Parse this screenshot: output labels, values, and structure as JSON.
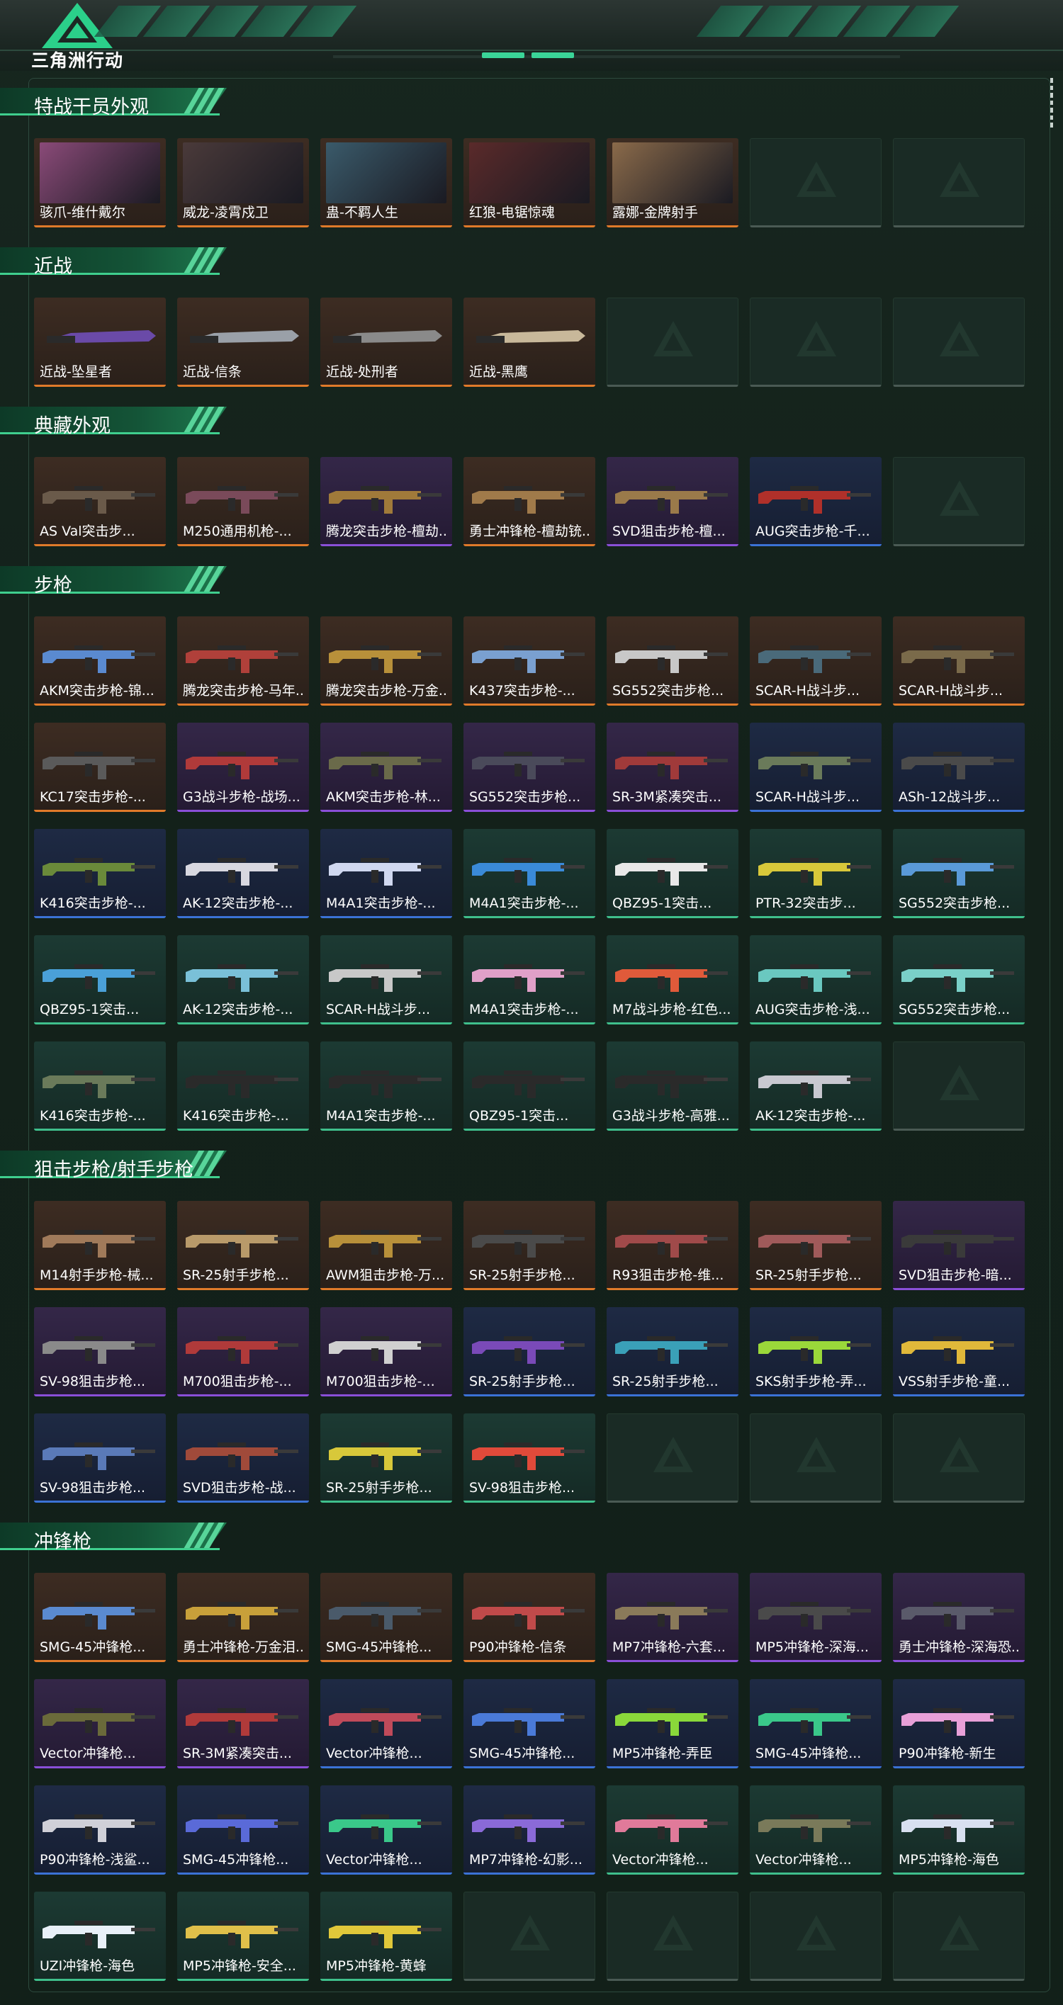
{
  "header": {
    "brand": "三角洲行动"
  },
  "colors": {
    "accent": "#3fcf8e",
    "orange": "#e07a2a",
    "purple": "#8a4fd8",
    "blue": "#3b72d6",
    "green": "#3fbf8c",
    "empty": "#4a5a54"
  },
  "sections": [
    {
      "title": "特战干员外观",
      "rows": [
        [
          {
            "name": "骇爪-维什戴尔",
            "rarity": "orange",
            "kind": "photo",
            "tint": "#8a4a78"
          },
          {
            "name": "威龙-凌霄戍卫",
            "rarity": "orange",
            "kind": "photo",
            "tint": "#4a3a3a"
          },
          {
            "name": "蛊-不羁人生",
            "rarity": "orange",
            "kind": "photo",
            "tint": "#3a5a6a"
          },
          {
            "name": "红狼-电锯惊魂",
            "rarity": "orange",
            "kind": "photo",
            "tint": "#5a2a2a"
          },
          {
            "name": "露娜-金牌射手",
            "rarity": "orange",
            "kind": "photo",
            "tint": "#8a6a4a"
          },
          {
            "name": "",
            "rarity": "empty"
          },
          {
            "name": "",
            "rarity": "empty"
          }
        ]
      ]
    },
    {
      "title": "近战",
      "rows": [
        [
          {
            "name": "近战-坠星者",
            "rarity": "orange",
            "kind": "knife",
            "tint": "#6a4aa8"
          },
          {
            "name": "近战-信条",
            "rarity": "orange",
            "kind": "knife",
            "tint": "#9aa0a8"
          },
          {
            "name": "近战-处刑者",
            "rarity": "orange",
            "kind": "knife",
            "tint": "#8a8a8a"
          },
          {
            "name": "近战-黑鹰",
            "rarity": "orange",
            "kind": "knife",
            "tint": "#c8b89a"
          },
          {
            "name": "",
            "rarity": "empty"
          },
          {
            "name": "",
            "rarity": "empty"
          },
          {
            "name": "",
            "rarity": "empty"
          }
        ]
      ]
    },
    {
      "title": "典藏外观",
      "rows": [
        [
          {
            "name": "AS Val突击步...",
            "rarity": "orange",
            "kind": "gun",
            "tint": "#6a5a4a"
          },
          {
            "name": "M250通用机枪-...",
            "rarity": "orange",
            "kind": "gun",
            "tint": "#7a4a5a"
          },
          {
            "name": "腾龙突击步枪-檀劫...",
            "rarity": "purple",
            "kind": "gun",
            "tint": "#a07a3a"
          },
          {
            "name": "勇士冲锋枪-檀劫铳...",
            "rarity": "orange",
            "kind": "gun",
            "tint": "#a07a4a"
          },
          {
            "name": "SVD狙击步枪-檀...",
            "rarity": "purple",
            "kind": "gun",
            "tint": "#9a7a4a"
          },
          {
            "name": "AUG突击步枪-千...",
            "rarity": "blue",
            "kind": "gun",
            "tint": "#b0302a"
          },
          {
            "name": "",
            "rarity": "empty"
          }
        ]
      ]
    },
    {
      "title": "步枪",
      "rows": [
        [
          {
            "name": "AKM突击步枪-锦...",
            "rarity": "orange",
            "kind": "gun",
            "tint": "#5a8ad0"
          },
          {
            "name": "腾龙突击步枪-马年...",
            "rarity": "orange",
            "kind": "gun",
            "tint": "#b0403a"
          },
          {
            "name": "腾龙突击步枪-万金...",
            "rarity": "orange",
            "kind": "gun",
            "tint": "#b8903a"
          },
          {
            "name": "K437突击步枪-...",
            "rarity": "orange",
            "kind": "gun",
            "tint": "#7aa0d0"
          },
          {
            "name": "SG552突击步枪...",
            "rarity": "orange",
            "kind": "gun",
            "tint": "#c8c8c8"
          },
          {
            "name": "SCAR-H战斗步...",
            "rarity": "orange",
            "kind": "gun",
            "tint": "#4a6a7a"
          },
          {
            "name": "SCAR-H战斗步...",
            "rarity": "orange",
            "kind": "gun",
            "tint": "#7a6a4a"
          }
        ],
        [
          {
            "name": "KC17突击步枪-...",
            "rarity": "orange",
            "kind": "gun",
            "tint": "#5a5a5a"
          },
          {
            "name": "G3战斗步枪-战场...",
            "rarity": "purple",
            "kind": "gun",
            "tint": "#b03a3a"
          },
          {
            "name": "AKM突击步枪-林...",
            "rarity": "purple",
            "kind": "gun",
            "tint": "#6a6a4a"
          },
          {
            "name": "SG552突击步枪...",
            "rarity": "purple",
            "kind": "gun",
            "tint": "#4a4a5a"
          },
          {
            "name": "SR-3M紧凑突击...",
            "rarity": "purple",
            "kind": "gun",
            "tint": "#a03a3a"
          },
          {
            "name": "SCAR-H战斗步...",
            "rarity": "blue",
            "kind": "gun",
            "tint": "#6a7a5a"
          },
          {
            "name": "ASh-12战斗步...",
            "rarity": "blue",
            "kind": "gun",
            "tint": "#4a4a4a"
          }
        ],
        [
          {
            "name": "K416突击步枪-...",
            "rarity": "blue",
            "kind": "gun",
            "tint": "#6a8a3a"
          },
          {
            "name": "AK-12突击步枪-...",
            "rarity": "blue",
            "kind": "gun",
            "tint": "#d8d8e0"
          },
          {
            "name": "M4A1突击步枪-...",
            "rarity": "blue",
            "kind": "gun",
            "tint": "#d0d8f0"
          },
          {
            "name": "M4A1突击步枪-...",
            "rarity": "green",
            "kind": "gun",
            "tint": "#3a8ad8"
          },
          {
            "name": "QBZ95-1突击...",
            "rarity": "green",
            "kind": "gun",
            "tint": "#e8e8e8"
          },
          {
            "name": "PTR-32突击步...",
            "rarity": "green",
            "kind": "gun",
            "tint": "#d8c83a"
          },
          {
            "name": "SG552突击步枪...",
            "rarity": "green",
            "kind": "gun",
            "tint": "#5a9ad8"
          }
        ],
        [
          {
            "name": "QBZ95-1突击...",
            "rarity": "green",
            "kind": "gun",
            "tint": "#4aa0d8"
          },
          {
            "name": "AK-12突击步枪-...",
            "rarity": "green",
            "kind": "gun",
            "tint": "#7ac0d8"
          },
          {
            "name": "SCAR-H战斗步...",
            "rarity": "green",
            "kind": "gun",
            "tint": "#c8c8c8"
          },
          {
            "name": "M4A1突击步枪-...",
            "rarity": "green",
            "kind": "gun",
            "tint": "#e0a0c8"
          },
          {
            "name": "M7战斗步枪-红色...",
            "rarity": "green",
            "kind": "gun",
            "tint": "#e05a3a"
          },
          {
            "name": "AUG突击步枪-浅...",
            "rarity": "green",
            "kind": "gun",
            "tint": "#6ac8c0"
          },
          {
            "name": "SG552突击步枪...",
            "rarity": "green",
            "kind": "gun",
            "tint": "#7ad0c8"
          }
        ],
        [
          {
            "name": "K416突击步枪-...",
            "rarity": "green",
            "kind": "gun",
            "tint": "#6a7a5a"
          },
          {
            "name": "K416突击步枪-...",
            "rarity": "green",
            "kind": "gun",
            "tint": "#2a2a2a"
          },
          {
            "name": "M4A1突击步枪-...",
            "rarity": "green",
            "kind": "gun",
            "tint": "#2a2a2a"
          },
          {
            "name": "QBZ95-1突击...",
            "rarity": "green",
            "kind": "gun",
            "tint": "#2a2a2a"
          },
          {
            "name": "G3战斗步枪-高雅...",
            "rarity": "green",
            "kind": "gun",
            "tint": "#2a2a2a"
          },
          {
            "name": "AK-12突击步枪-...",
            "rarity": "green",
            "kind": "gun",
            "tint": "#c8c8d0"
          },
          {
            "name": "",
            "rarity": "empty"
          }
        ]
      ]
    },
    {
      "title": "狙击步枪/射手步枪",
      "rows": [
        [
          {
            "name": "M14射手步枪-械...",
            "rarity": "orange",
            "kind": "gun",
            "tint": "#a07a5a"
          },
          {
            "name": "SR-25射手步枪...",
            "rarity": "orange",
            "kind": "gun",
            "tint": "#b89a6a"
          },
          {
            "name": "AWM狙击步枪-万...",
            "rarity": "orange",
            "kind": "gun",
            "tint": "#b8903a"
          },
          {
            "name": "SR-25射手步枪...",
            "rarity": "orange",
            "kind": "gun",
            "tint": "#4a4a4a"
          },
          {
            "name": "R93狙击步枪-维...",
            "rarity": "orange",
            "kind": "gun",
            "tint": "#a04a4a"
          },
          {
            "name": "SR-25射手步枪...",
            "rarity": "orange",
            "kind": "gun",
            "tint": "#a05a5a"
          },
          {
            "name": "SVD狙击步枪-暗...",
            "rarity": "purple",
            "kind": "gun",
            "tint": "#3a3a3a"
          }
        ],
        [
          {
            "name": "SV-98狙击步枪...",
            "rarity": "purple",
            "kind": "gun",
            "tint": "#8a8a8a"
          },
          {
            "name": "M700狙击步枪-...",
            "rarity": "purple",
            "kind": "gun",
            "tint": "#b03a3a"
          },
          {
            "name": "M700狙击步枪-...",
            "rarity": "purple",
            "kind": "gun",
            "tint": "#d0d0d0"
          },
          {
            "name": "SR-25射手步枪...",
            "rarity": "blue",
            "kind": "gun",
            "tint": "#7a4ab8"
          },
          {
            "name": "SR-25射手步枪...",
            "rarity": "blue",
            "kind": "gun",
            "tint": "#3aa0b8"
          },
          {
            "name": "SKS射手步枪-弄...",
            "rarity": "blue",
            "kind": "gun",
            "tint": "#9ad83a"
          },
          {
            "name": "VSS射手步枪-童...",
            "rarity": "blue",
            "kind": "gun",
            "tint": "#e0b83a"
          }
        ],
        [
          {
            "name": "SV-98狙击步枪...",
            "rarity": "blue",
            "kind": "gun",
            "tint": "#5a7ab8"
          },
          {
            "name": "SVD狙击步枪-战...",
            "rarity": "blue",
            "kind": "gun",
            "tint": "#a04a3a"
          },
          {
            "name": "SR-25射手步枪...",
            "rarity": "green",
            "kind": "gun",
            "tint": "#d8c83a"
          },
          {
            "name": "SV-98狙击步枪...",
            "rarity": "green",
            "kind": "gun",
            "tint": "#e04a3a"
          },
          {
            "name": "",
            "rarity": "empty"
          },
          {
            "name": "",
            "rarity": "empty"
          },
          {
            "name": "",
            "rarity": "empty"
          }
        ]
      ]
    },
    {
      "title": "冲锋枪",
      "rows": [
        [
          {
            "name": "SMG-45冲锋枪...",
            "rarity": "orange",
            "kind": "gun",
            "tint": "#5a8ad0"
          },
          {
            "name": "勇士冲锋枪-万金泪...",
            "rarity": "orange",
            "kind": "gun",
            "tint": "#c8a03a"
          },
          {
            "name": "SMG-45冲锋枪...",
            "rarity": "orange",
            "kind": "gun",
            "tint": "#4a5a6a"
          },
          {
            "name": "P90冲锋枪-信条",
            "rarity": "orange",
            "kind": "gun",
            "tint": "#c04a4a"
          },
          {
            "name": "MP7冲锋枪-六套...",
            "rarity": "purple",
            "kind": "gun",
            "tint": "#8a7a5a"
          },
          {
            "name": "MP5冲锋枪-深海...",
            "rarity": "purple",
            "kind": "gun",
            "tint": "#4a4a4a"
          },
          {
            "name": "勇士冲锋枪-深海恐...",
            "rarity": "purple",
            "kind": "gun",
            "tint": "#5a5a6a"
          }
        ],
        [
          {
            "name": "Vector冲锋枪...",
            "rarity": "purple",
            "kind": "gun",
            "tint": "#6a6a3a"
          },
          {
            "name": "SR-3M紧凑突击...",
            "rarity": "purple",
            "kind": "gun",
            "tint": "#b03a3a"
          },
          {
            "name": "Vector冲锋枪...",
            "rarity": "blue",
            "kind": "gun",
            "tint": "#c04a5a"
          },
          {
            "name": "SMG-45冲锋枪...",
            "rarity": "blue",
            "kind": "gun",
            "tint": "#4a7ad8"
          },
          {
            "name": "MP5冲锋枪-弄臣",
            "rarity": "blue",
            "kind": "gun",
            "tint": "#8ad83a"
          },
          {
            "name": "SMG-45冲锋枪...",
            "rarity": "blue",
            "kind": "gun",
            "tint": "#3ac88a"
          },
          {
            "name": "P90冲锋枪-新生",
            "rarity": "blue",
            "kind": "gun",
            "tint": "#e8a0d8"
          }
        ],
        [
          {
            "name": "P90冲锋枪-浅鲨...",
            "rarity": "blue",
            "kind": "gun",
            "tint": "#d0d0d8"
          },
          {
            "name": "SMG-45冲锋枪...",
            "rarity": "blue",
            "kind": "gun",
            "tint": "#5a6ad8"
          },
          {
            "name": "Vector冲锋枪...",
            "rarity": "blue",
            "kind": "gun",
            "tint": "#3ac88a"
          },
          {
            "name": "MP7冲锋枪-幻影...",
            "rarity": "blue",
            "kind": "gun",
            "tint": "#8a6ad8"
          },
          {
            "name": "Vector冲锋枪...",
            "rarity": "green",
            "kind": "gun",
            "tint": "#e07a9a"
          },
          {
            "name": "Vector冲锋枪...",
            "rarity": "green",
            "kind": "gun",
            "tint": "#7a7a5a"
          },
          {
            "name": "MP5冲锋枪-海色",
            "rarity": "green",
            "kind": "gun",
            "tint": "#d8e0f0"
          }
        ],
        [
          {
            "name": "UZI冲锋枪-海色",
            "rarity": "green",
            "kind": "gun",
            "tint": "#e8f0f8"
          },
          {
            "name": "MP5冲锋枪-安全...",
            "rarity": "green",
            "kind": "gun",
            "tint": "#e0c04a"
          },
          {
            "name": "MP5冲锋枪-黄蜂",
            "rarity": "green",
            "kind": "gun",
            "tint": "#e0c83a"
          },
          {
            "name": "",
            "rarity": "empty"
          },
          {
            "name": "",
            "rarity": "empty"
          },
          {
            "name": "",
            "rarity": "empty"
          },
          {
            "name": "",
            "rarity": "empty"
          }
        ]
      ]
    }
  ]
}
